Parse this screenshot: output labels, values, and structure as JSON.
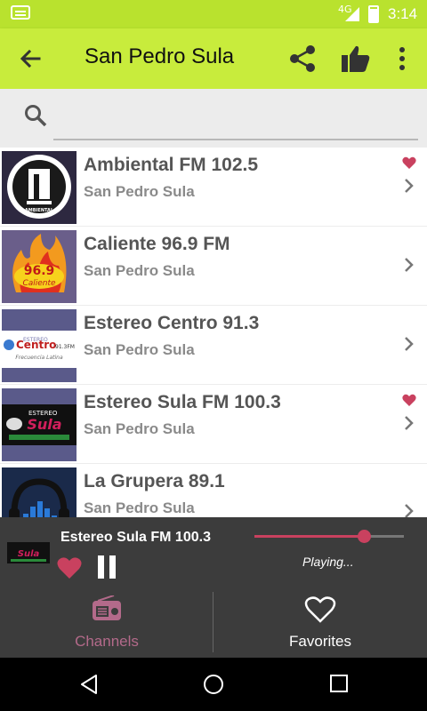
{
  "status_bar": {
    "network": "4G",
    "time": "3:14"
  },
  "app_bar": {
    "title": "San Pedro Sula"
  },
  "search": {
    "placeholder": ""
  },
  "stations": [
    {
      "name": "Ambiental FM 102.5",
      "city": "San Pedro Sula",
      "favorite": true,
      "logo_text": "AMBIENTAL"
    },
    {
      "name": "Caliente 96.9 FM",
      "city": "San Pedro Sula",
      "favorite": false,
      "logo_text": "96.9"
    },
    {
      "name": "Estereo Centro 91.3",
      "city": "San Pedro Sula",
      "favorite": false,
      "logo_text": "Centro"
    },
    {
      "name": "Estereo Sula FM 100.3",
      "city": "San Pedro Sula",
      "favorite": true,
      "logo_text": "Sula"
    },
    {
      "name": "La Grupera 89.1",
      "city": "San Pedro Sula",
      "favorite": false,
      "logo_text": ""
    }
  ],
  "player": {
    "station": "Estereo Sula FM 100.3",
    "status": "Playing...",
    "volume_fraction": 0.73
  },
  "tabs": [
    {
      "label": "Channels",
      "active": true
    },
    {
      "label": "Favorites",
      "active": false
    }
  ],
  "colors": {
    "accent": "#c8ec3c",
    "heart": "#c9415f",
    "player_bg": "#3c3c3c",
    "channels_tab": "#b36a8a"
  }
}
